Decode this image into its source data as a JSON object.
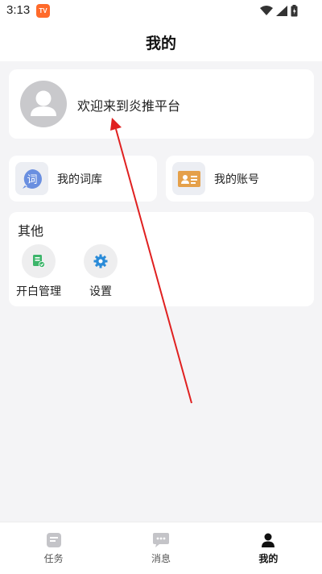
{
  "status_bar": {
    "time": "3:13",
    "app_badge": "TV"
  },
  "header": {
    "title": "我的"
  },
  "profile": {
    "welcome": "欢迎来到炎推平台"
  },
  "quick_cards": [
    {
      "label": "我的词库",
      "icon": "lexicon-icon",
      "color": "#6a8fe0"
    },
    {
      "label": "我的账号",
      "icon": "account-card-icon",
      "color": "#e5a04a"
    }
  ],
  "other_section": {
    "title": "其他",
    "items": [
      {
        "label": "开白管理",
        "icon": "whitelist-icon",
        "color": "#3cb56a"
      },
      {
        "label": "设置",
        "icon": "settings-gear-icon",
        "color": "#2a8bd8"
      }
    ]
  },
  "tabbar": {
    "tabs": [
      {
        "label": "任务",
        "icon": "task-icon",
        "active": false
      },
      {
        "label": "消息",
        "icon": "message-icon",
        "active": false
      },
      {
        "label": "我的",
        "icon": "profile-icon",
        "active": true
      }
    ]
  },
  "annotation": {
    "color": "#e02020"
  }
}
